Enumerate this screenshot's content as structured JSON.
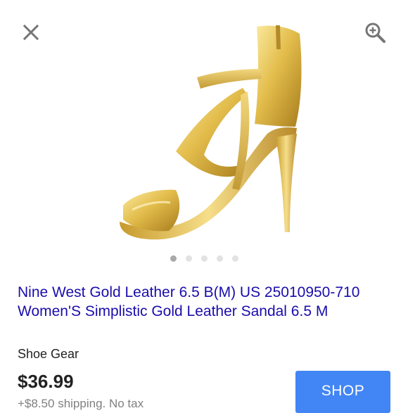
{
  "toolbar": {
    "close_icon": "close-icon",
    "zoom_icon": "zoom-in-icon"
  },
  "product": {
    "title": "Nine West Gold Leather 6.5 B(M) US 25010950-710 Women'S Simplistic Gold Leather Sandal 6.5 M",
    "merchant": "Shoe Gear",
    "price": "$36.99",
    "shipping": "+$8.50 shipping. No tax",
    "shop_label": "SHOP",
    "image": {
      "subject": "gold leather high-heel sandal"
    }
  },
  "carousel": {
    "count": 5,
    "active_index": 0
  },
  "colors": {
    "link": "#1a0dab",
    "button": "#4285f4",
    "icon": "#757575",
    "dot_active": "#a9a9a9",
    "dot_inactive": "#e2e2e2"
  }
}
